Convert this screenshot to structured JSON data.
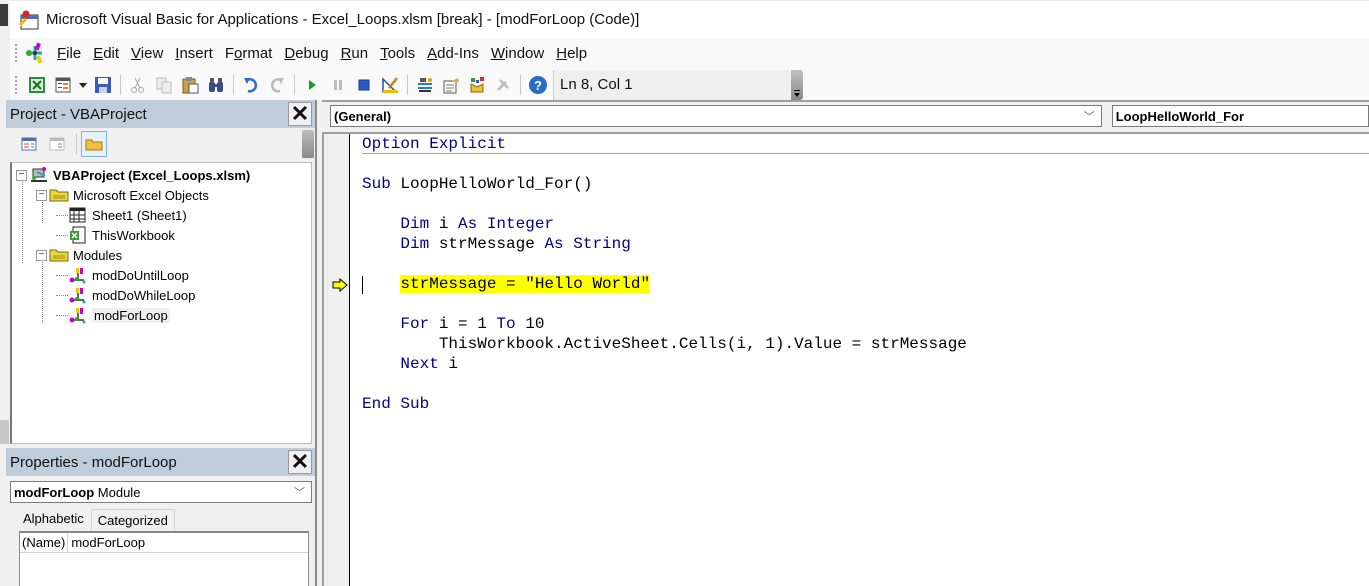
{
  "window": {
    "title": "Microsoft Visual Basic for Applications - Excel_Loops.xlsm [break] - [modForLoop (Code)]"
  },
  "menu": [
    {
      "label": "File",
      "accel": "F",
      "rest": "ile"
    },
    {
      "label": "Edit",
      "accel": "E",
      "rest": "dit"
    },
    {
      "label": "View",
      "accel": "V",
      "rest": "iew"
    },
    {
      "label": "Insert",
      "accel": "I",
      "rest": "nsert"
    },
    {
      "label": "Format",
      "pre": "F",
      "accel": "o",
      "rest": "rmat"
    },
    {
      "label": "Debug",
      "accel": "D",
      "rest": "ebug"
    },
    {
      "label": "Run",
      "accel": "R",
      "rest": "un"
    },
    {
      "label": "Tools",
      "accel": "T",
      "rest": "ools"
    },
    {
      "label": "Add-Ins",
      "accel": "A",
      "rest": "dd-Ins"
    },
    {
      "label": "Window",
      "accel": "W",
      "rest": "indow"
    },
    {
      "label": "Help",
      "accel": "H",
      "rest": "elp"
    }
  ],
  "toolbar": {
    "buttons": [
      "view-excel",
      "insert-userform",
      "save",
      "cut",
      "copy",
      "paste",
      "find",
      "undo",
      "redo",
      "run",
      "break",
      "reset",
      "design-mode",
      "project-explorer",
      "properties-window",
      "object-browser",
      "toolbox",
      "help"
    ],
    "status": "Ln 8, Col 1"
  },
  "project": {
    "header": "Project - VBAProject",
    "tree": [
      {
        "label": "VBAProject (Excel_Loops.xlsm)",
        "level": 0,
        "type": "project",
        "bold": true,
        "expanded": true
      },
      {
        "label": "Microsoft Excel Objects",
        "level": 1,
        "type": "folder",
        "expanded": true
      },
      {
        "label": "Sheet1 (Sheet1)",
        "level": 2,
        "type": "sheet"
      },
      {
        "label": "ThisWorkbook",
        "level": 2,
        "type": "workbook"
      },
      {
        "label": "Modules",
        "level": 1,
        "type": "folder",
        "expanded": true
      },
      {
        "label": "modDoUntilLoop",
        "level": 2,
        "type": "module"
      },
      {
        "label": "modDoWhileLoop",
        "level": 2,
        "type": "module"
      },
      {
        "label": "modForLoop",
        "level": 2,
        "type": "module",
        "selected": true
      }
    ]
  },
  "properties": {
    "header": "Properties - modForLoop",
    "object_name": "modForLoop",
    "object_type": "Module",
    "tabs": [
      "Alphabetic",
      "Categorized"
    ],
    "active_tab": "Alphabetic",
    "rows": [
      {
        "key": "(Name)",
        "value": "modForLoop"
      }
    ]
  },
  "code": {
    "object_combo": "(General)",
    "procedure_combo": "LoopHelloWorld_For",
    "execution_line": 6,
    "colors": {
      "keyword": "#00008b",
      "highlight": "#ffff00"
    },
    "lines": [
      [
        {
          "t": "Option Explicit",
          "k": true
        }
      ],
      [],
      [
        {
          "t": "Sub ",
          "k": true
        },
        {
          "t": "LoopHelloWorld_For()"
        }
      ],
      [],
      [
        {
          "t": "    "
        },
        {
          "t": "Dim ",
          "k": true
        },
        {
          "t": "i "
        },
        {
          "t": "As Integer",
          "k": true
        }
      ],
      [
        {
          "t": "    "
        },
        {
          "t": "Dim ",
          "k": true
        },
        {
          "t": "strMessage "
        },
        {
          "t": "As String",
          "k": true
        }
      ],
      [],
      [
        {
          "t": "    "
        },
        {
          "t": "strMessage = \"Hello World\"",
          "hl": true
        }
      ],
      [],
      [
        {
          "t": "    "
        },
        {
          "t": "For ",
          "k": true
        },
        {
          "t": "i = 1 "
        },
        {
          "t": "To ",
          "k": true
        },
        {
          "t": "10"
        }
      ],
      [
        {
          "t": "        ThisWorkbook.ActiveSheet.Cells(i, 1).Value = strMessage"
        }
      ],
      [
        {
          "t": "    "
        },
        {
          "t": "Next ",
          "k": true
        },
        {
          "t": "i"
        }
      ],
      [],
      [
        {
          "t": "End Sub",
          "k": true
        }
      ]
    ]
  }
}
